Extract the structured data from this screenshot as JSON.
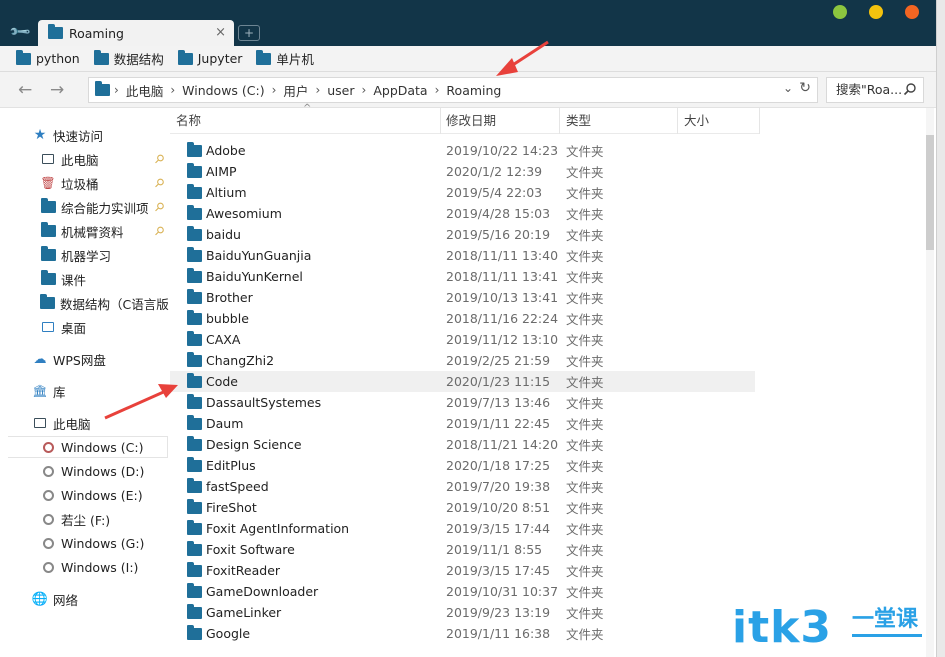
{
  "window": {
    "tab_title": "Roaming",
    "tab_close": "×",
    "new_tab": "+",
    "traffic_colors": [
      "#8cc63f",
      "#f4c20d",
      "#f26522"
    ]
  },
  "bookmarks": [
    {
      "label": "python"
    },
    {
      "label": "数据结构"
    },
    {
      "label": "Jupyter"
    },
    {
      "label": "单片机"
    }
  ],
  "nav": {
    "back": "←",
    "forward": "→"
  },
  "address": {
    "crumbs": [
      "此电脑",
      "Windows (C:)",
      "用户",
      "user",
      "AppData",
      "Roaming"
    ],
    "separator": "›",
    "dropdown": "⌄",
    "refresh": "↻"
  },
  "search": {
    "placeholder": "搜索\"Roa...",
    "icon": "search-icon"
  },
  "columns": {
    "name": "名称",
    "modified": "修改日期",
    "type": "类型",
    "size": "大小",
    "sort": "^"
  },
  "sidebar": {
    "quick_access": "快速访问",
    "quick_items": [
      {
        "label": "此电脑",
        "icon": "computer-icon",
        "pinned": true
      },
      {
        "label": "垃圾桶",
        "icon": "trash-icon",
        "pinned": true
      },
      {
        "label": "综合能力实训项",
        "icon": "folder-icon",
        "pinned": true
      },
      {
        "label": "机械臂资料",
        "icon": "folder-icon",
        "pinned": true
      },
      {
        "label": "机器学习",
        "icon": "folder-icon",
        "pinned": false
      },
      {
        "label": "课件",
        "icon": "folder-icon",
        "pinned": false
      },
      {
        "label": "数据结构（C语言版",
        "icon": "folder-icon",
        "pinned": false
      },
      {
        "label": "桌面",
        "icon": "desktop-icon",
        "pinned": false
      }
    ],
    "wps": "WPS网盘",
    "library": "库",
    "this_pc": "此电脑",
    "drives": [
      {
        "label": "Windows (C:)",
        "selected": true
      },
      {
        "label": "Windows (D:)",
        "selected": false
      },
      {
        "label": "Windows (E:)",
        "selected": false
      },
      {
        "label": "若尘 (F:)",
        "selected": false
      },
      {
        "label": "Windows (G:)",
        "selected": false
      },
      {
        "label": "Windows (I:)",
        "selected": false
      }
    ],
    "network": "网络",
    "pin_glyph": "⚲"
  },
  "files": [
    {
      "name": "Adobe",
      "date": "2019/10/22 14:23",
      "type": "文件夹"
    },
    {
      "name": "AIMP",
      "date": "2020/1/2 12:39",
      "type": "文件夹"
    },
    {
      "name": "Altium",
      "date": "2019/5/4 22:03",
      "type": "文件夹"
    },
    {
      "name": "Awesomium",
      "date": "2019/4/28 15:03",
      "type": "文件夹"
    },
    {
      "name": "baidu",
      "date": "2019/5/16 20:19",
      "type": "文件夹"
    },
    {
      "name": "BaiduYunGuanjia",
      "date": "2018/11/11 13:40",
      "type": "文件夹"
    },
    {
      "name": "BaiduYunKernel",
      "date": "2018/11/11 13:41",
      "type": "文件夹"
    },
    {
      "name": "Brother",
      "date": "2019/10/13 13:41",
      "type": "文件夹"
    },
    {
      "name": "bubble",
      "date": "2018/11/16 22:24",
      "type": "文件夹"
    },
    {
      "name": "CAXA",
      "date": "2019/11/12 13:10",
      "type": "文件夹"
    },
    {
      "name": "ChangZhi2",
      "date": "2019/2/25 21:59",
      "type": "文件夹"
    },
    {
      "name": "Code",
      "date": "2020/1/23 11:15",
      "type": "文件夹",
      "highlight": true
    },
    {
      "name": "DassaultSystemes",
      "date": "2019/7/13 13:46",
      "type": "文件夹"
    },
    {
      "name": "Daum",
      "date": "2019/1/11 22:45",
      "type": "文件夹"
    },
    {
      "name": "Design Science",
      "date": "2018/11/21 14:20",
      "type": "文件夹"
    },
    {
      "name": "EditPlus",
      "date": "2020/1/18 17:25",
      "type": "文件夹"
    },
    {
      "name": "fastSpeed",
      "date": "2019/7/20 19:38",
      "type": "文件夹"
    },
    {
      "name": "FireShot",
      "date": "2019/10/20 8:51",
      "type": "文件夹"
    },
    {
      "name": "Foxit AgentInformation",
      "date": "2019/3/15 17:44",
      "type": "文件夹"
    },
    {
      "name": "Foxit Software",
      "date": "2019/11/1 8:55",
      "type": "文件夹"
    },
    {
      "name": "FoxitReader",
      "date": "2019/3/15 17:45",
      "type": "文件夹"
    },
    {
      "name": "GameDownloader",
      "date": "2019/10/31 10:37",
      "type": "文件夹"
    },
    {
      "name": "GameLinker",
      "date": "2019/9/23 13:19",
      "type": "文件夹"
    },
    {
      "name": "Google",
      "date": "2019/1/11 16:38",
      "type": "文件夹"
    }
  ],
  "watermark": {
    "latin": "itk3",
    "cn": "一堂课"
  },
  "annotation_color": "#e8413b"
}
